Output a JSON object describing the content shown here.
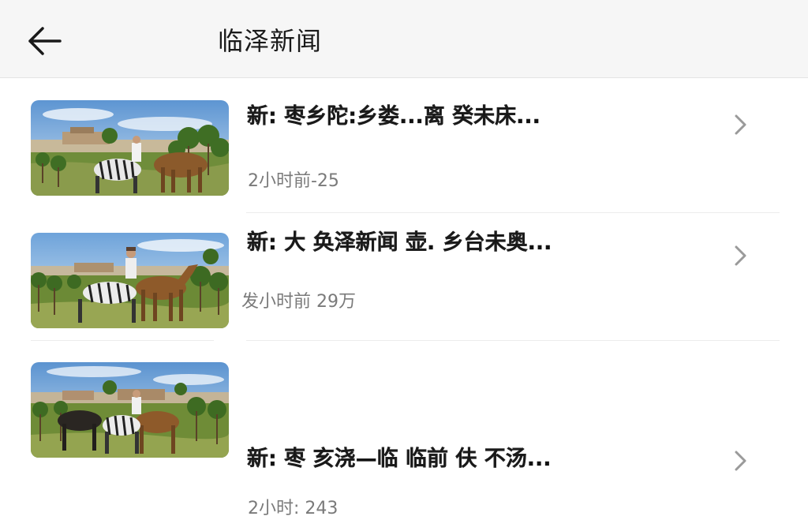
{
  "header": {
    "title": "临泽新闻",
    "back_icon": "arrow-left-icon"
  },
  "news": [
    {
      "title": "新: 枣乡陀:乡娄...离 癸未床...",
      "meta": "2小时前-25",
      "thumbnail": "zebra-and-horse-in-vineyard-image"
    },
    {
      "title": "新: 大 奂泽新闻 壶. 乡台未奥...",
      "meta": "发小时前 29万",
      "thumbnail": "man-with-zebra-and-horse-image"
    },
    {
      "title": "新: 枣 亥浇—临 临前 伕 不汤...",
      "meta": "2小时: 243",
      "thumbnail": "horses-and-zebra-in-vineyard-image"
    }
  ],
  "colors": {
    "header_bg": "#f6f6f6",
    "meta_text": "#7a7a7a",
    "chevron": "#9a9a9a"
  }
}
